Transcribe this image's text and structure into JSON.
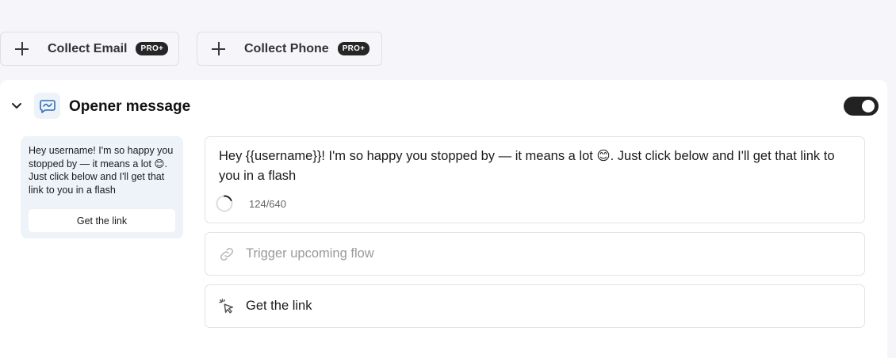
{
  "top_actions": {
    "collect_email": {
      "label": "Collect Email",
      "badge": "PRO+",
      "icon": "plus-icon"
    },
    "collect_phone": {
      "label": "Collect Phone",
      "badge": "PRO+",
      "icon": "plus-icon"
    }
  },
  "opener": {
    "title": "Opener message",
    "icon": "chat-message-icon",
    "enabled": true,
    "preview": {
      "text": "Hey username! I'm so happy you stopped by — it means a lot 😊. Just click below and I'll get that link to you in a flash",
      "button_label": "Get the link"
    },
    "editor": {
      "text": "Hey {{username}}! I'm so happy you stopped by — it means a lot 😊. Just click below and I'll get that link to you in a flash",
      "char_count": "124/640"
    },
    "trigger_field": {
      "placeholder": "Trigger upcoming flow",
      "icon": "link-icon"
    },
    "button_field": {
      "label": "Get the link",
      "icon": "click-cursor-icon"
    }
  },
  "colors": {
    "page_bg": "#f6f6fa",
    "card_bg": "#ffffff",
    "toggle_on": "#222222",
    "preview_bg": "#eef3f9",
    "icon_accent": "#2f6fb8"
  }
}
